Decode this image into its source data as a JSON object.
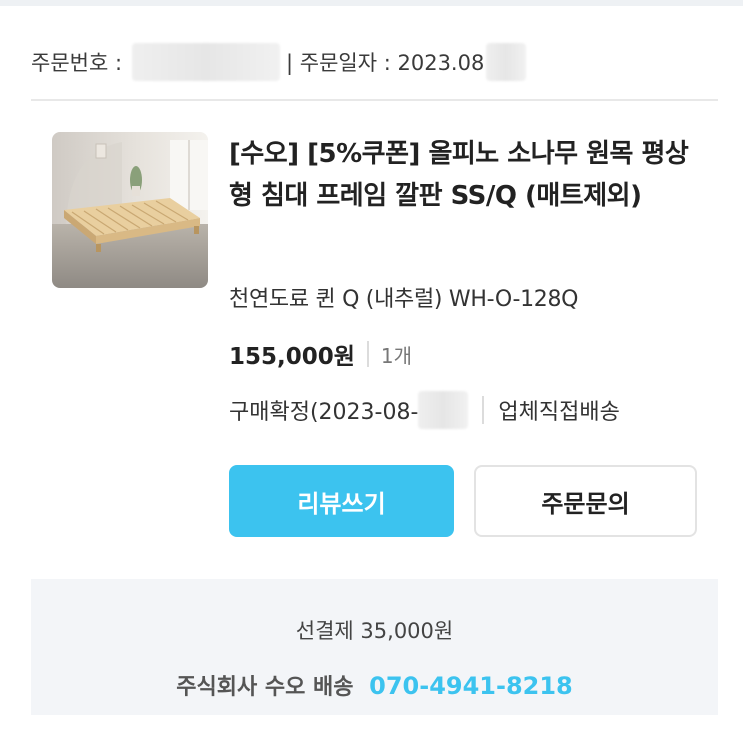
{
  "order": {
    "number_label": "주문번호 :",
    "date_label": "| 주문일자 : 2023.08"
  },
  "product": {
    "title": "[수오] [5%쿠폰] 올피노 소나무 원목 평상형 침대 프레임 깔판 SS/Q (매트제외)",
    "option": "천연도료 퀸 Q (내추럴) WH-O-128Q",
    "price": "155,000원",
    "quantity": "1개",
    "status": "구매확정(2023-08-",
    "shipping": "업체직접배송",
    "image": "bed-frame-product-image"
  },
  "buttons": {
    "review": "리뷰쓰기",
    "inquiry": "주문문의"
  },
  "footer": {
    "prepaid": "선결제 35,000원",
    "company": "주식회사 수오 배송",
    "phone": "070-4941-8218"
  },
  "colors": {
    "accent": "#3cc3ef",
    "footer_bg": "#f3f5f8"
  }
}
